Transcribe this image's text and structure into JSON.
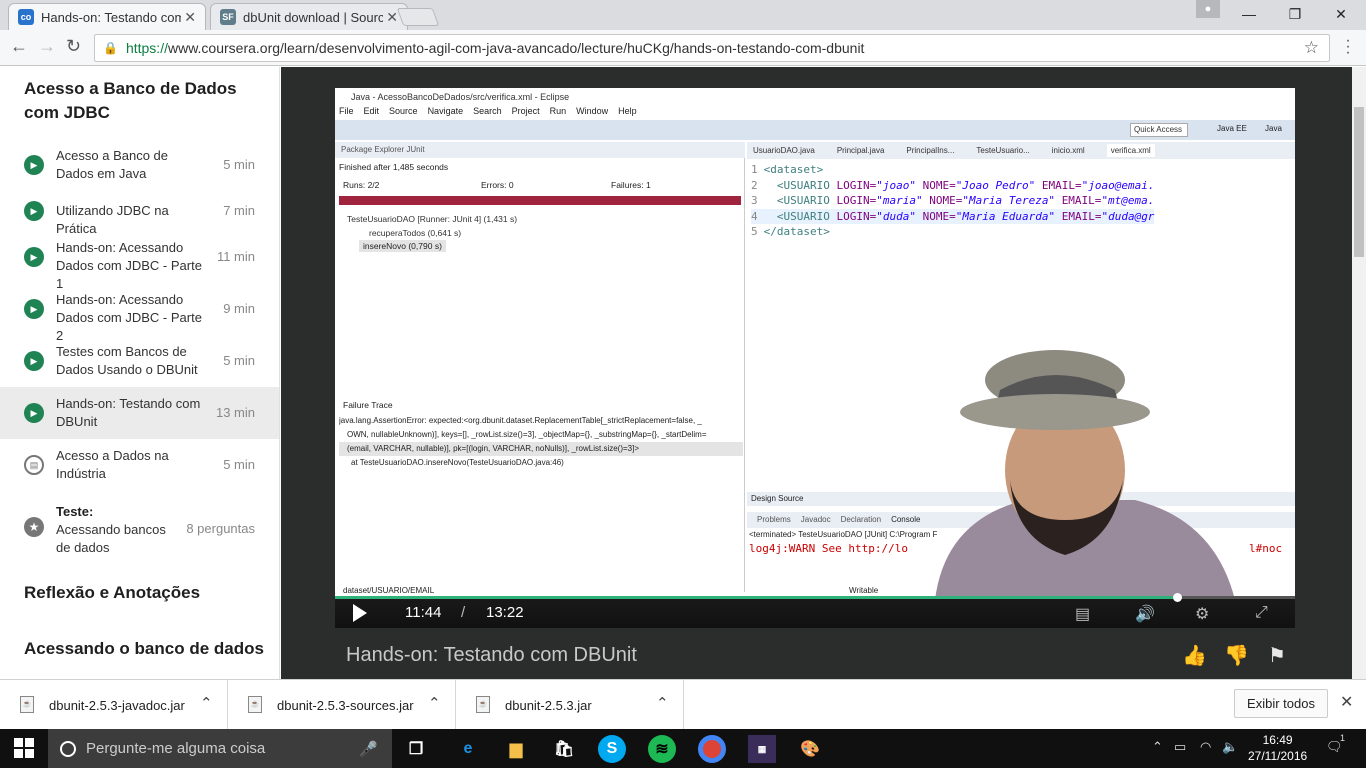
{
  "browser": {
    "tabs": [
      {
        "title": "Hands-on: Testando com",
        "favicon": "coursera-icon",
        "active": true
      },
      {
        "title": "dbUnit download | Sourc",
        "favicon": "sourceforge-icon",
        "active": false
      }
    ],
    "url_scheme": "https://",
    "url_rest": "www.coursera.org/learn/desenvolvimento-agil-com-java-avancado/lecture/huCKg/hands-on-testando-com-dbunit"
  },
  "sidebar": {
    "section_title": "Acesso a Banco de Dados com JDBC",
    "items": [
      {
        "label": "Acesso a Banco de Dados em Java",
        "duration": "5 min",
        "type": "video"
      },
      {
        "label": "Utilizando JDBC na Prática",
        "duration": "7 min",
        "type": "video"
      },
      {
        "label": "Hands-on: Acessando Dados com JDBC - Parte 1",
        "duration": "11 min",
        "type": "video"
      },
      {
        "label": "Hands-on: Acessando Dados com JDBC - Parte 2",
        "duration": "9 min",
        "type": "video"
      },
      {
        "label": "Testes com Bancos de Dados Usando o DBUnit",
        "duration": "5 min",
        "type": "video"
      },
      {
        "label": "Hands-on: Testando com DBUnit",
        "duration": "13 min",
        "type": "video"
      },
      {
        "label": "Acesso a Dados na Indústria",
        "duration": "5 min",
        "type": "reading"
      }
    ],
    "quiz": {
      "heading": "Teste:",
      "label": "Acessando bancos de dados",
      "count": "8 perguntas"
    },
    "next_sections": [
      "Reflexão e Anotações",
      "Acessando o banco de dados"
    ]
  },
  "video": {
    "eclipse": {
      "window_title": "Java - AcessoBancoDeDados/src/verifica.xml - Eclipse",
      "menu": [
        "File",
        "Edit",
        "Source",
        "Navigate",
        "Search",
        "Project",
        "Run",
        "Window",
        "Help"
      ],
      "quick_access": "Quick Access",
      "perspectives": [
        "Java EE",
        "Java"
      ],
      "panel_tabs": "Package Explorer   JUnit",
      "finished": "Finished after 1,485 seconds",
      "runs": "Runs:  2/2",
      "errors": "Errors:  0",
      "failures": "Failures:  1",
      "test_class": "TesteUsuarioDAO [Runner: JUnit 4] (1,431 s)",
      "test_time_1": "recuperaTodos (0,641 s)",
      "test_time_2": "insereNovo (0,790 s)",
      "failure_trace_title": "Failure Trace",
      "trace": [
        "java.lang.AssertionError: expected:<org.dbunit.dataset.ReplacementTable[_strictReplacement=false, _",
        "OWN, nullableUnknown)], keys=[], _rowList.size()=3], _objectMap={}, _substringMap={}, _startDelim=",
        "(email, VARCHAR, nullable)], pk=[(login, VARCHAR, noNulls)], _rowList.size()=3]>",
        "at TesteUsuarioDAO.insereNovo(TesteUsuarioDAO.java:46)"
      ],
      "editor_tabs": [
        "UsuarioDAO.java",
        "Principal.java",
        "PrincipalIns...",
        "TesteUsuario...",
        "inicio.xml",
        "verifica.xml"
      ],
      "code": [
        {
          "n": "1",
          "open": "<dataset>"
        },
        {
          "n": "2",
          "tag": "<USUARIO",
          "login": "\"joao\"",
          "nome": "\"Joao Pedro\"",
          "email": "\"joao@emai."
        },
        {
          "n": "3",
          "tag": "<USUARIO",
          "login": "\"maria\"",
          "nome": "\"Maria Tereza\"",
          "email": "\"mt@ema."
        },
        {
          "n": "4",
          "tag": "<USUARIO",
          "login": "\"duda\"",
          "nome": "\"Maria Eduarda\"",
          "email": "\"duda@gr"
        },
        {
          "n": "5",
          "open": "</dataset>"
        }
      ],
      "attr_login": "LOGIN=",
      "attr_nome": "NOME=",
      "attr_email": "EMAIL=",
      "design_source": "Design  Source",
      "console_tabs": [
        "Problems",
        "Javadoc",
        "Declaration",
        "Console"
      ],
      "console_terminated": "<terminated> TesteUsuarioDAO [JUnit] C:\\Program F",
      "console_log": "log4j:WARN See http://lo",
      "console_tail": "l#noc",
      "status_path": "dataset/USUARIO/EMAIL",
      "status_mode": "Writable"
    },
    "current_time": "11:44",
    "separator": "/",
    "total_time": "13:22",
    "progress_fraction": 0.877,
    "title": "Hands-on: Testando com DBUnit"
  },
  "downloads": {
    "files": [
      "dbunit-2.5.3-javadoc.jar",
      "dbunit-2.5.3-sources.jar",
      "dbunit-2.5.3.jar"
    ],
    "show_all": "Exibir todos"
  },
  "taskbar": {
    "search_placeholder": "Pergunte-me alguma coisa",
    "time": "16:49",
    "date": "27/11/2016",
    "notification_count": "1"
  },
  "colors": {
    "accent_green": "#1f8354",
    "coursera_blue": "#2a73cc",
    "junit_fail": "#a0243e",
    "progress": "#2fb17c"
  }
}
